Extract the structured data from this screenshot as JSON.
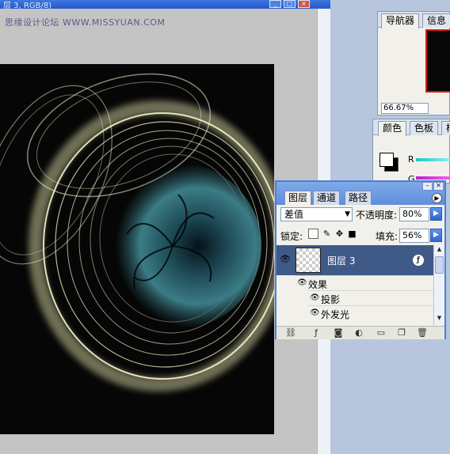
{
  "document": {
    "title": "层 3, RGB/8)",
    "min_btn": "_",
    "max_btn": "□",
    "close_btn": "×",
    "watermark": "思缘设计论坛 WWW.MISSYUAN.COM"
  },
  "navigator": {
    "tabs": [
      "导航器",
      "信息"
    ],
    "zoom": "66.67%"
  },
  "color": {
    "tabs": [
      "颜色",
      "色板",
      "样"
    ],
    "r_label": "R",
    "g_label": "G"
  },
  "layers": {
    "tabs": [
      "图层",
      "通道",
      "路径"
    ],
    "blend_mode": "差值",
    "opacity_label": "不透明度:",
    "opacity_value": "80%",
    "lock_label": "锁定:",
    "fill_label": "填充:",
    "fill_value": "56%",
    "layer_name": "图层 3",
    "effects_label": "效果",
    "effect_1": "投影",
    "effect_2": "外发光",
    "colors": {
      "selected_row": "#3f5a86",
      "header": "#6b9be0"
    }
  }
}
